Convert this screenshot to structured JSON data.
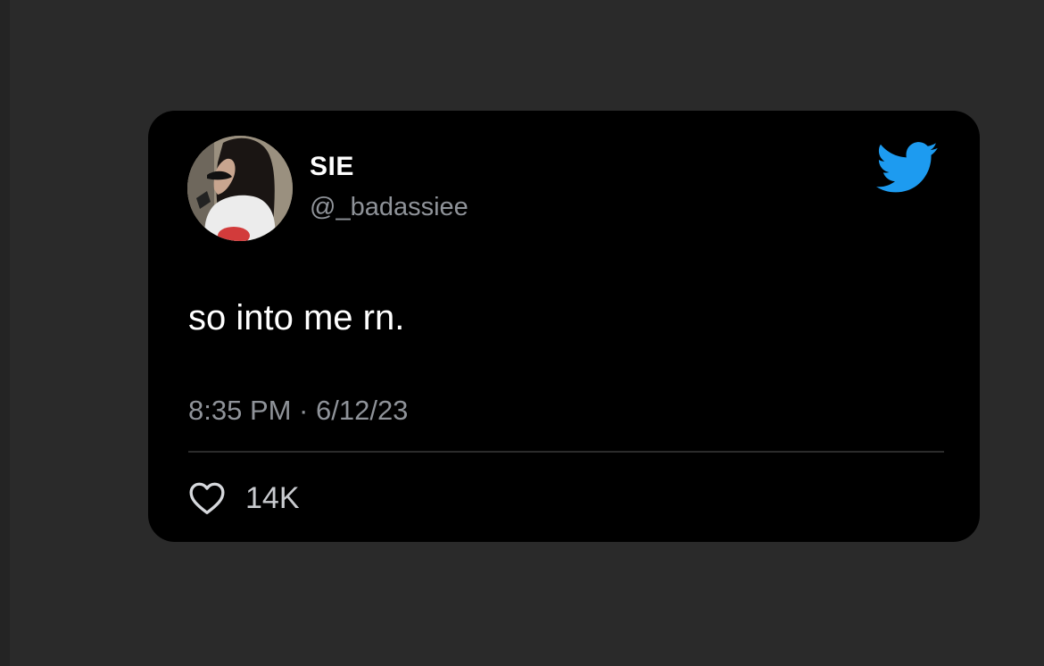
{
  "tweet": {
    "display_name": "SIE",
    "handle": "@_badassiee",
    "text": "so into me rn.",
    "timestamp": "8:35 PM · 6/12/23",
    "likes": "14K"
  },
  "icons": {
    "logo": "twitter-bird-icon",
    "like": "heart-icon"
  },
  "colors": {
    "background": "#2a2a2a",
    "card": "#000000",
    "twitter_blue": "#1d9bf0",
    "secondary_text": "#8f9399"
  }
}
